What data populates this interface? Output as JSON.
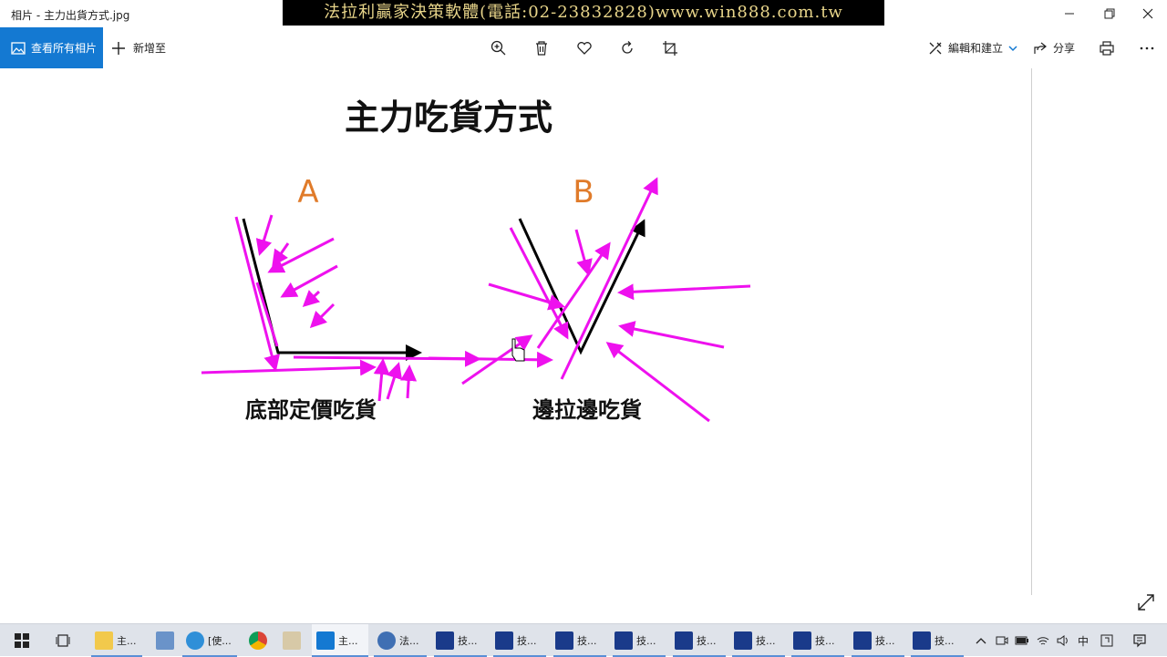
{
  "window": {
    "title": "相片 - 主力出貨方式.jpg",
    "banner": "法拉利贏家決策軟體(電話:02-23832828)www.win888.com.tw"
  },
  "toolbar": {
    "view_all_label": "查看所有相片",
    "add_to_label": "新增至",
    "edit_create_label": "編輯和建立",
    "share_label": "分享"
  },
  "image": {
    "title": "主力吃貨方式",
    "label_a": "A",
    "label_b": "B",
    "caption_a": "底部定價吃貨",
    "caption_b": "邊拉邊吃貨"
  },
  "taskbar": {
    "items": [
      "主...",
      "[使...",
      "主...",
      "法...",
      "技...",
      "技...",
      "技...",
      "技...",
      "技...",
      "技...",
      "技...",
      "技...",
      "技..."
    ],
    "ime_label": "中"
  },
  "colors": {
    "accent": "#1479d2",
    "arrow_magenta": "#ee11ee",
    "label_orange": "#e07b2a",
    "banner_text": "#e8d58a"
  }
}
